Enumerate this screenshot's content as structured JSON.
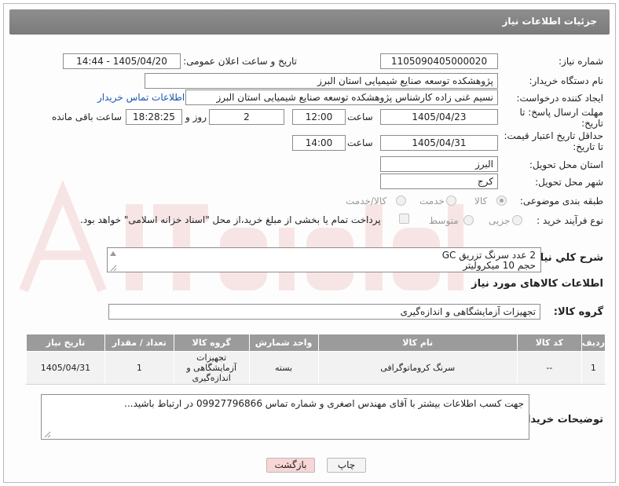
{
  "header": {
    "title": "جزئیات اطلاعات نیاز"
  },
  "form": {
    "need_number_label": "شماره نیاز:",
    "need_number": "1105090405000020",
    "announce_label": "تاریخ و ساعت اعلان عمومی:",
    "announce_value": "1405/04/20 - 14:44",
    "buyer_org_label": "نام دستگاه خریدار:",
    "buyer_org": "پژوهشکده توسعه صنایع شیمیایی استان البرز",
    "creator_label": "ایجاد کننده درخواست:",
    "creator": "نسیم غنی زاده کارشناس پژوهشکده توسعه صنایع شیمیایی استان البرز",
    "contact_link": "اطلاعات تماس خریدار",
    "reply_deadline_label": "مهلت ارسال پاسخ: تا تاریخ:",
    "reply_date": "1405/04/23",
    "time_label": "ساعت",
    "reply_time": "12:00",
    "days": "2",
    "days_label": "روز و",
    "remaining_time": "18:28:25",
    "remaining_label": "ساعت باقی مانده",
    "price_deadline_label": "حداقل تاریخ اعتبار قیمت: تا تاریخ:",
    "price_date": "1405/04/31",
    "price_time": "14:00",
    "province_label": "استان محل تحویل:",
    "province": "البرز",
    "city_label": "شهر محل تحویل:",
    "city": "کرج",
    "category_label": "طبقه بندی موضوعی:",
    "category_options": [
      "کالا",
      "خدمت",
      "کالا/خدمت"
    ],
    "process_label": "نوع فرآیند خرید :",
    "process_options": [
      "جزیی",
      "متوسط"
    ],
    "payment_note": "پرداخت تمام یا بخشی از مبلغ خرید،از محل \"اسناد خزانه اسلامی\" خواهد بود."
  },
  "description": {
    "label": "شرح كلي نياز:",
    "line1": "2 عدد سرنگ تزریق GC",
    "line2": "حجم 10 میکرولیتر"
  },
  "goods": {
    "section_title": "اطلاعات کالاهای مورد نیاز",
    "group_label": "گروه کالا:",
    "group_value": "تجهیزات آزمایشگاهی و اندازه‌گیری",
    "columns": [
      "ردیف",
      "کد کالا",
      "نام کالا",
      "واحد شمارش",
      "گروه کالا",
      "تعداد / مقدار",
      "تاریخ نیاز"
    ],
    "rows": [
      {
        "index": "1",
        "code": "--",
        "name": "سرنگ کروماتوگرافی",
        "unit": "بسته",
        "group_l1": "تجهیزات",
        "group_l2": "آزمایشگاهی و",
        "group_l3": "اندازه‌گیری",
        "qty": "1",
        "date": "1405/04/31"
      }
    ]
  },
  "buyer_notes": {
    "label": "توضیحات خریدار:",
    "text": "جهت کسب اطلاعات بیشتر با آقای مهندس اصغری و شماره تماس 09927796866 در ارتباط باشید..."
  },
  "buttons": {
    "print": "چاپ",
    "back": "بازگشت"
  },
  "colors": {
    "header_bg": "#858585",
    "link": "#1b57b0",
    "back_button": "#f8d6d6"
  }
}
